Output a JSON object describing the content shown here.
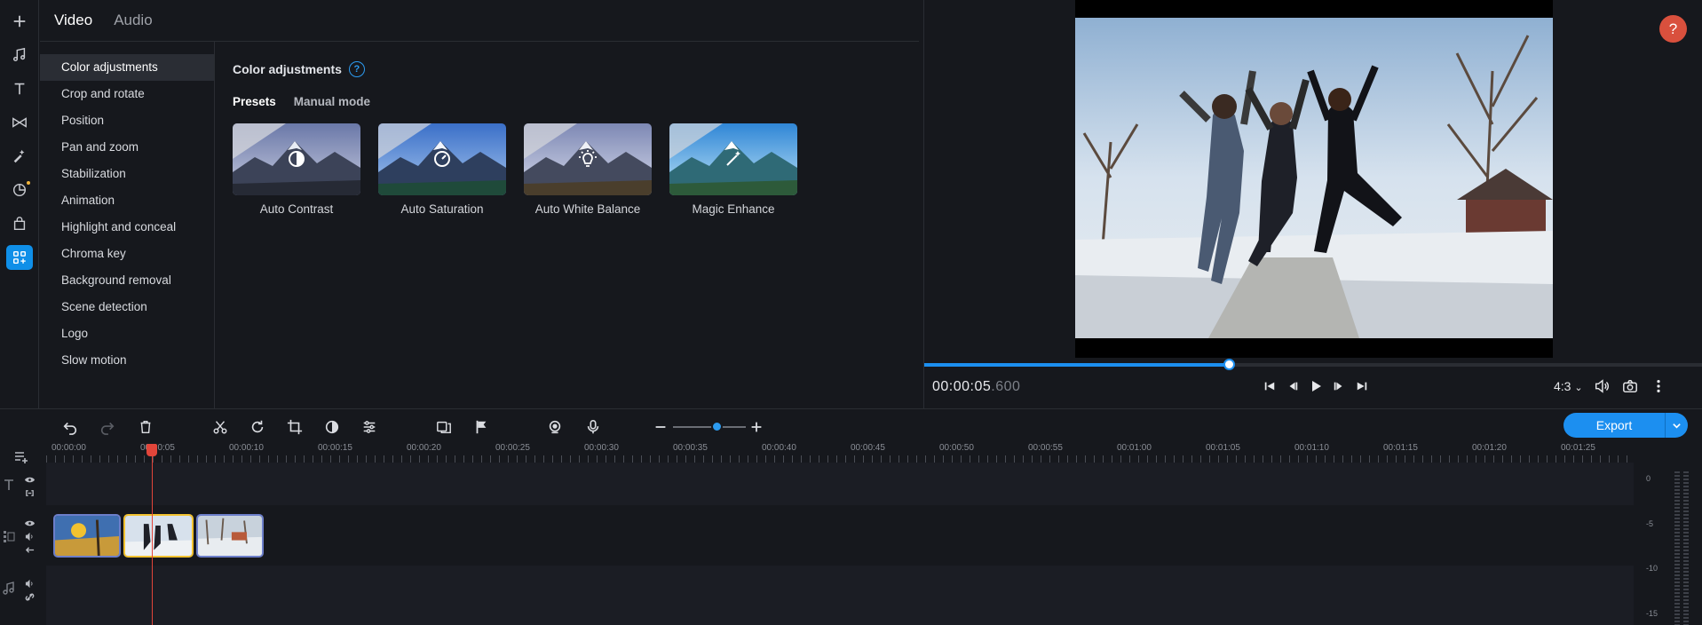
{
  "rail": {
    "items": [
      {
        "name": "add-media",
        "icon": "plus-icon"
      },
      {
        "name": "music",
        "icon": "music-note-icon"
      },
      {
        "name": "titles",
        "icon": "text-icon"
      },
      {
        "name": "transitions",
        "icon": "transition-icon"
      },
      {
        "name": "filters",
        "icon": "magic-wand-icon"
      },
      {
        "name": "stickers",
        "icon": "sticker-icon"
      },
      {
        "name": "store",
        "icon": "shopping-bag-icon"
      },
      {
        "name": "more-tools",
        "icon": "tools-grid-icon"
      }
    ]
  },
  "editor": {
    "tabs": [
      "Video",
      "Audio"
    ],
    "tools": [
      "Color adjustments",
      "Crop and rotate",
      "Position",
      "Pan and zoom",
      "Stabilization",
      "Animation",
      "Highlight and conceal",
      "Chroma key",
      "Background removal",
      "Scene detection",
      "Logo",
      "Slow motion"
    ],
    "section_title": "Color adjustments",
    "help_glyph": "?",
    "subtabs": [
      "Presets",
      "Manual mode"
    ],
    "presets": [
      {
        "label": "Auto Contrast",
        "icon": "contrast-icon"
      },
      {
        "label": "Auto Saturation",
        "icon": "saturation-gauge-icon"
      },
      {
        "label": "Auto White Balance",
        "icon": "lightbulb-icon"
      },
      {
        "label": "Magic Enhance",
        "icon": "magic-wand-icon"
      }
    ]
  },
  "preview": {
    "help_glyph": "?",
    "timecode_main": "00:00:05",
    "timecode_ms": ".600",
    "progress_fraction": 0.391,
    "aspect_ratio": "4:3"
  },
  "toolbar": {
    "export_label": "Export"
  },
  "timeline": {
    "ruler_labels": [
      "00:00:00",
      "00:00:05",
      "00:00:10",
      "00:00:15",
      "00:00:20",
      "00:00:25",
      "00:00:30",
      "00:00:35",
      "00:00:40",
      "00:00:45",
      "00:00:50",
      "00:00:55",
      "00:01:00",
      "00:01:05",
      "00:01:10",
      "00:01:15",
      "00:01:20",
      "00:01:25"
    ],
    "meter_labels": [
      "0",
      "-5",
      "-10",
      "-15"
    ],
    "clips": [
      "clip-1",
      "clip-2",
      "clip-3"
    ]
  },
  "colors": {
    "accent": "#1c8ff0",
    "playhead": "#e2453a",
    "selected_clip": "#f2c230",
    "help_button": "#d9503d"
  }
}
